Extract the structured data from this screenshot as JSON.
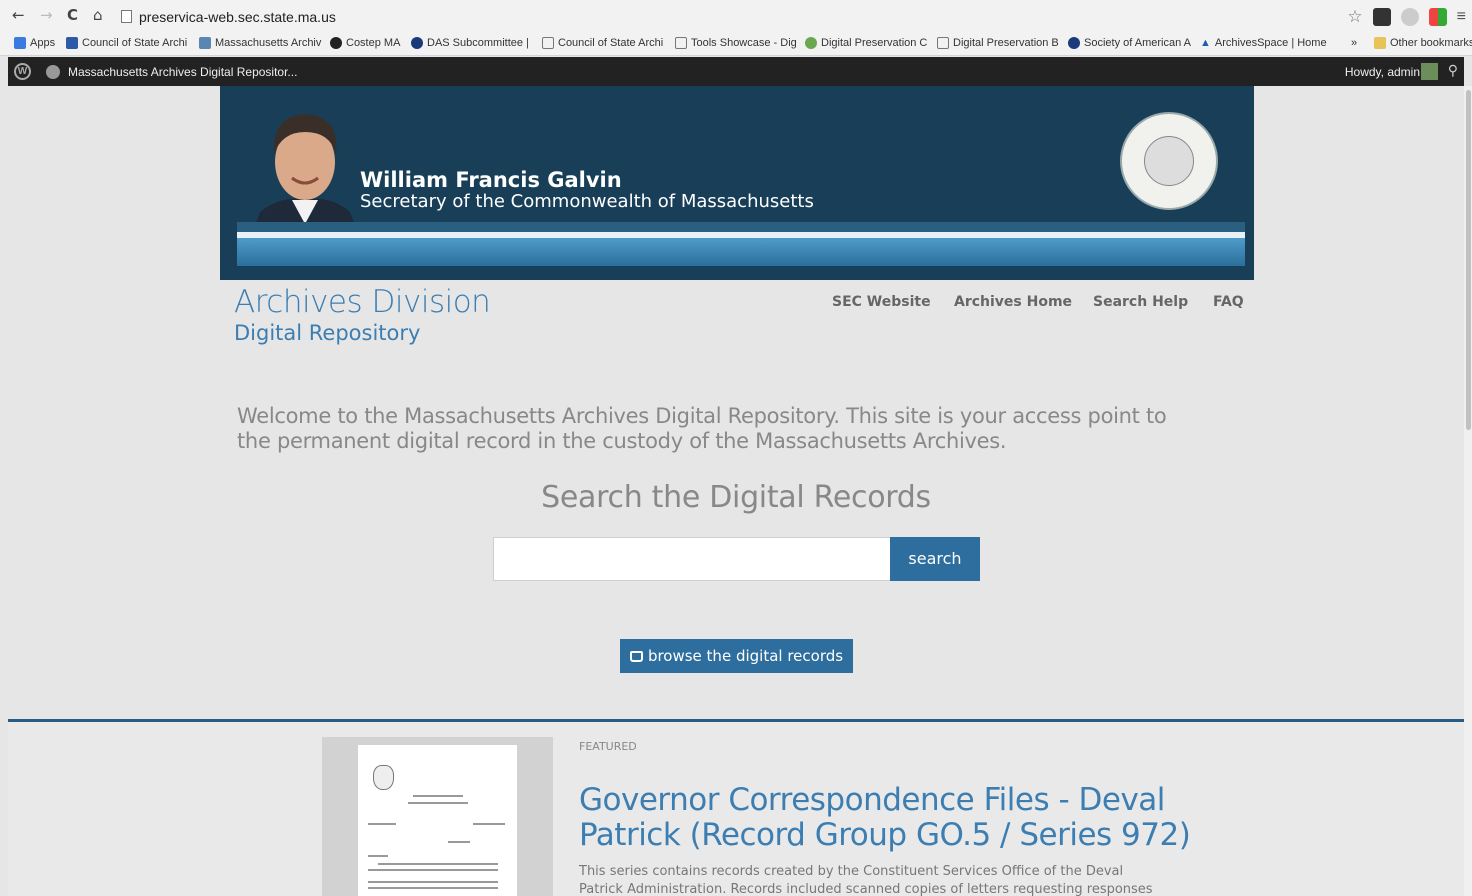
{
  "browser": {
    "url": "preservica-web.sec.state.ma.us",
    "bookmarks": [
      {
        "label": "Apps"
      },
      {
        "label": "Council of State Archi"
      },
      {
        "label": "Massachusetts Archiv"
      },
      {
        "label": "Costep MA"
      },
      {
        "label": "DAS Subcommittee |"
      },
      {
        "label": "Council of State Archi"
      },
      {
        "label": "Tools Showcase - Dig"
      },
      {
        "label": "Digital Preservation C"
      },
      {
        "label": "Digital Preservation B"
      },
      {
        "label": "Society of American A"
      },
      {
        "label": "ArchivesSpace | Home"
      }
    ],
    "more": "»",
    "other_bookmarks": "Other bookmarks"
  },
  "adminbar": {
    "site_name": "Massachusetts Archives Digital Repositor...",
    "howdy": "Howdy, admin"
  },
  "banner": {
    "name": "William Francis Galvin",
    "title": "Secretary of the Commonwealth of Massachusetts"
  },
  "site": {
    "title": "Archives Division",
    "subtitle": "Digital Repository"
  },
  "nav": {
    "items": [
      {
        "label": "SEC Website"
      },
      {
        "label": "Archives Home"
      },
      {
        "label": "Search Help"
      },
      {
        "label": "FAQ"
      }
    ]
  },
  "welcome": "Welcome to the Massachusetts Archives Digital Repository. This site is your access point to the permanent digital record in the custody of the Massachusetts Archives.",
  "search": {
    "heading": "Search the Digital Records",
    "value": "",
    "button": "search"
  },
  "browse_button": "browse the digital records",
  "featured": {
    "label": "FEATURED",
    "title": "Governor Correspondence Files - Deval Patrick (Record Group GO.5 / Series 972)",
    "description": "This series contains records created by the Constituent Services Office of the Deval Patrick Administration. Records included scanned copies of letters requesting responses or"
  },
  "colors": {
    "accent": "#2d6e9e",
    "banner": "#183f57",
    "title_blue": "#3c7eb2"
  }
}
